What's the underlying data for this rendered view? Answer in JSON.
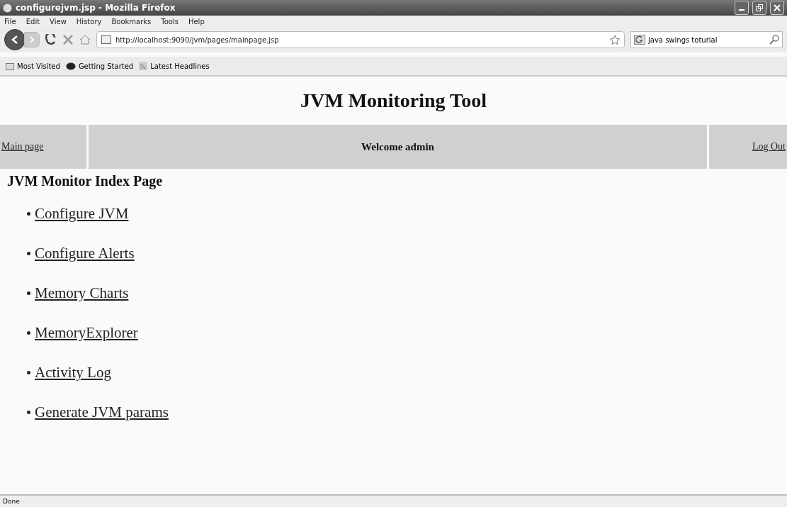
{
  "window": {
    "title": "configurejvm.jsp - Mozilla Firefox"
  },
  "menu": [
    "File",
    "Edit",
    "View",
    "History",
    "Bookmarks",
    "Tools",
    "Help"
  ],
  "address": {
    "value": "http://localhost:9090/jvm/pages/mainpage.jsp"
  },
  "search": {
    "value": "java swings toturial"
  },
  "bookmarks": [
    {
      "label": "Most Visited",
      "kind": "folder"
    },
    {
      "label": "Getting Started",
      "kind": "page"
    },
    {
      "label": "Latest Headlines",
      "kind": "feed"
    }
  ],
  "page": {
    "heading": "JVM Monitoring Tool",
    "nav": {
      "left": "Main page",
      "center": "Welcome admin",
      "right": "Log Out"
    },
    "subheading": "JVM Monitor Index Page",
    "links": [
      "Configure JVM",
      "Configure Alerts",
      "Memory Charts",
      "MemoryExplorer",
      "Activity Log",
      "Generate JVM params"
    ]
  },
  "status_bar": "Done"
}
